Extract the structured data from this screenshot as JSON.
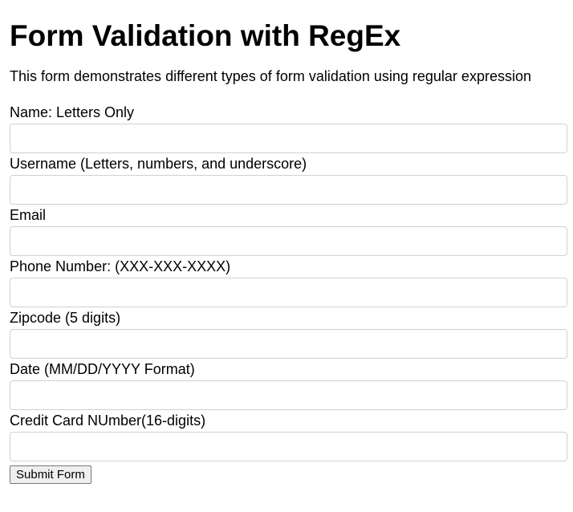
{
  "header": {
    "title": "Form Validation with RegEx",
    "description": "This form demonstrates different types of form validation using regular expression"
  },
  "form": {
    "fields": [
      {
        "label": "Name: Letters Only",
        "value": "",
        "placeholder": ""
      },
      {
        "label": "Username (Letters, numbers, and underscore)",
        "value": "",
        "placeholder": ""
      },
      {
        "label": "Email",
        "value": "",
        "placeholder": ""
      },
      {
        "label": "Phone Number: (XXX-XXX-XXXX)",
        "value": "",
        "placeholder": ""
      },
      {
        "label": "Zipcode (5 digits)",
        "value": "",
        "placeholder": ""
      },
      {
        "label": "Date (MM/DD/YYYY Format)",
        "value": "",
        "placeholder": ""
      },
      {
        "label": "Credit Card NUmber(16-digits)",
        "value": "",
        "placeholder": ""
      }
    ],
    "submit_label": "Submit Form"
  }
}
